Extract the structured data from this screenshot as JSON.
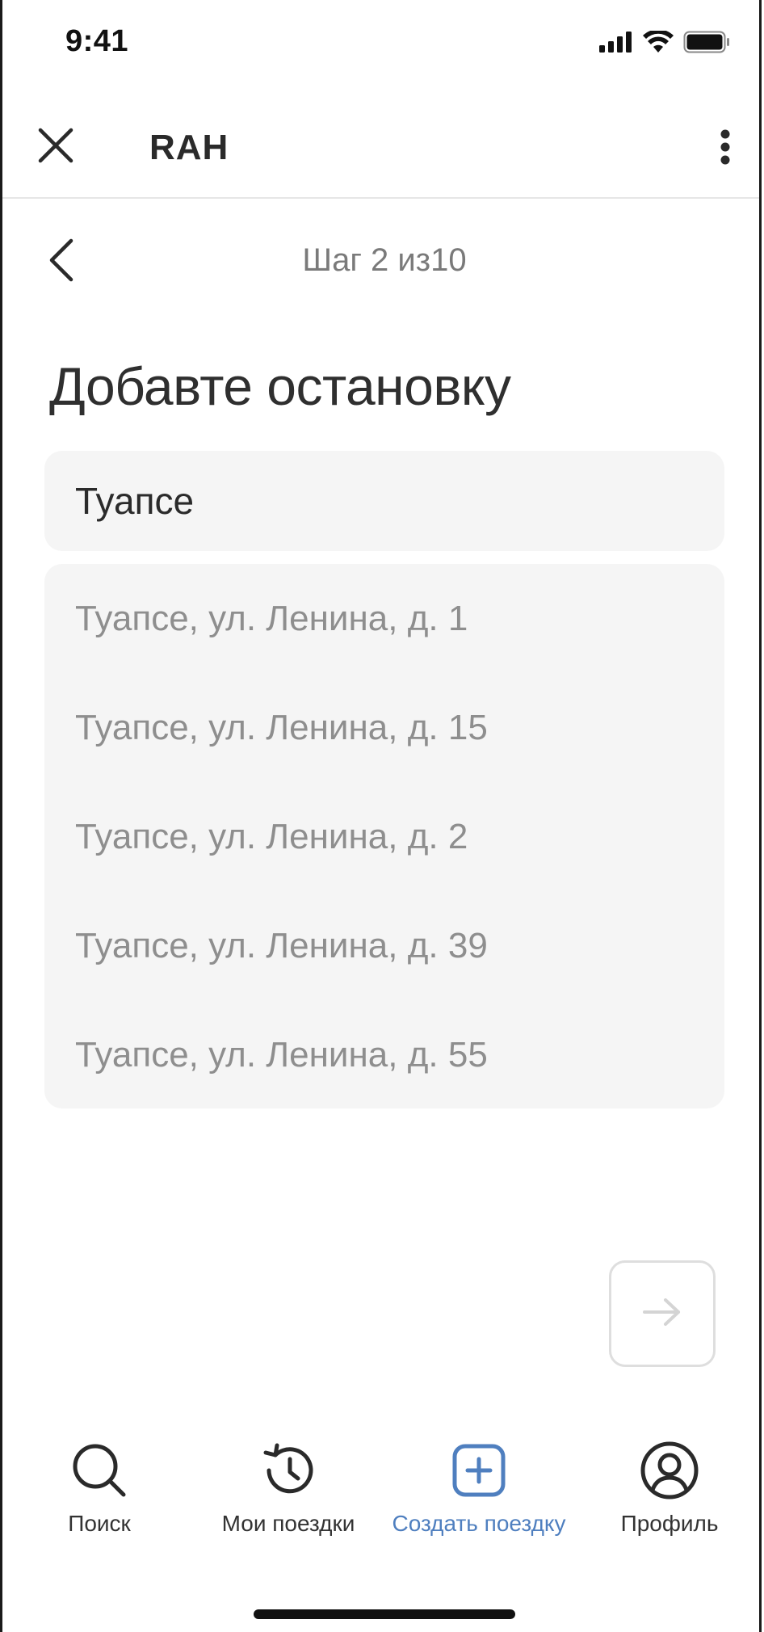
{
  "status_bar": {
    "time": "9:41",
    "icons": [
      "signal-icon",
      "wifi-icon",
      "battery-icon"
    ]
  },
  "header": {
    "title": "RAH",
    "close_icon": "close-icon",
    "more_icon": "more-vertical-icon"
  },
  "step": {
    "label": "Шаг 2 из10",
    "back_icon": "chevron-left-icon"
  },
  "page": {
    "title": "Добавте остановку"
  },
  "search": {
    "value": "Туапсе",
    "placeholder": ""
  },
  "suggestions": [
    "Туапсе, ул. Ленина, д. 1",
    "Туапсе, ул. Ленина, д. 15",
    "Туапсе, ул. Ленина, д. 2",
    "Туапсе, ул. Ленина, д. 39",
    "Туапсе, ул. Ленина, д. 55"
  ],
  "next_button": {
    "icon": "arrow-right-icon",
    "enabled": false
  },
  "bottom_nav": {
    "items": [
      {
        "label": "Поиск",
        "icon": "search-icon",
        "active": false
      },
      {
        "label": "Мои поездки",
        "icon": "history-icon",
        "active": false
      },
      {
        "label": "Создать поездку",
        "icon": "plus-square-icon",
        "active": true
      },
      {
        "label": "Профиль",
        "icon": "user-circle-icon",
        "active": false
      }
    ]
  },
  "colors": {
    "accent": "#4f7fbf",
    "field_bg": "#f5f5f5",
    "muted_text": "#8e8e8e"
  }
}
